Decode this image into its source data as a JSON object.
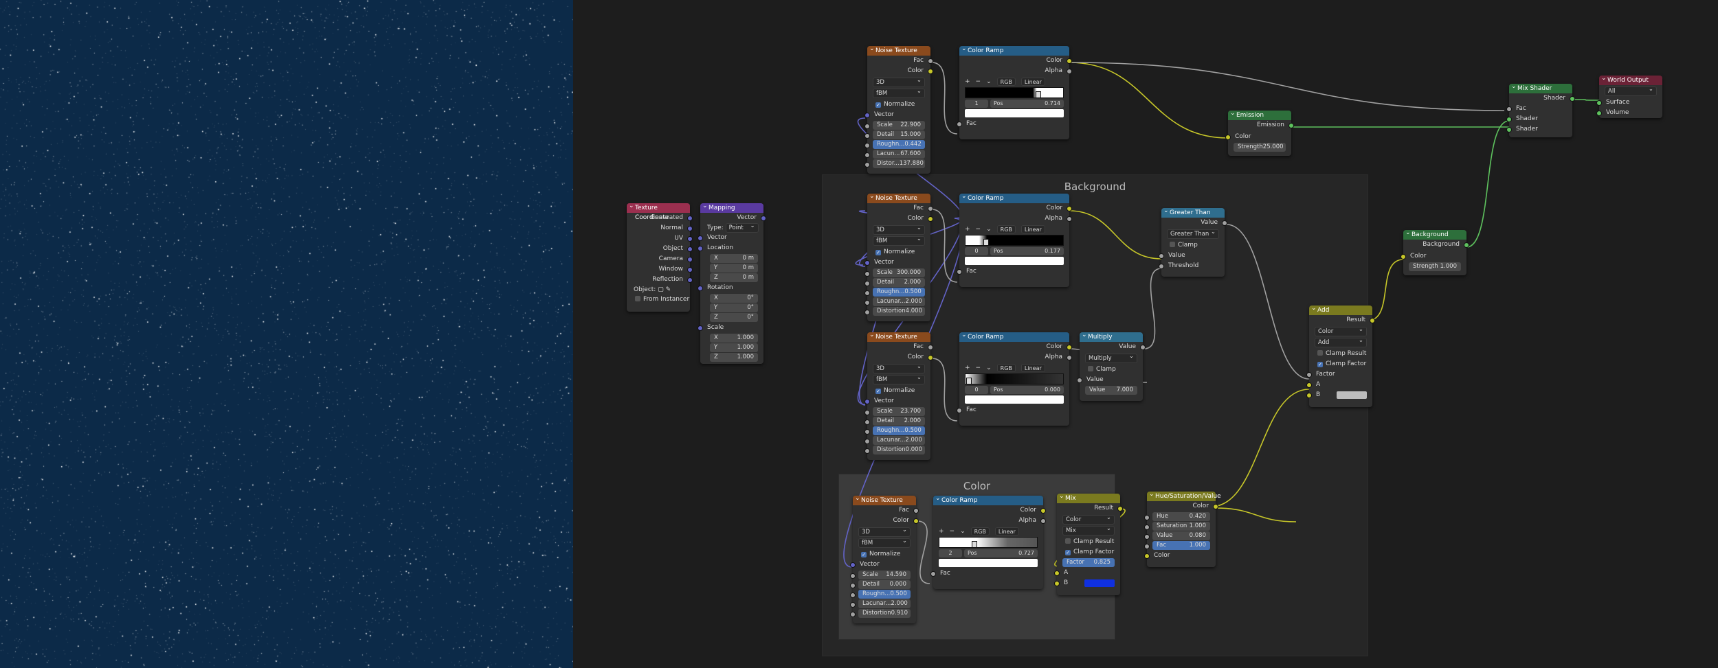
{
  "frames": {
    "background": "Background",
    "color": "Color"
  },
  "labels": {
    "fac": "Fac",
    "color": "Color",
    "alpha": "Alpha",
    "vector": "Vector",
    "normalize": "Normalize",
    "scale": "Scale",
    "detail": "Detail",
    "roughness": "Roughn...",
    "lacunarity": "Lacun...",
    "lacunarity2": "Lacunar...",
    "distortion": "Distor...",
    "distortion_full": "Distortion",
    "rgb": "RGB",
    "linear": "Linear",
    "pos": "Pos",
    "dim3d": "3D",
    "fbm": "fBM",
    "shader": "Shader",
    "surface": "Surface",
    "volume": "Volume",
    "all": "All",
    "emission": "Emission",
    "strength": "Strength",
    "value": "Value",
    "threshold": "Threshold",
    "clamp": "Clamp",
    "result": "Result",
    "factor": "Factor",
    "a": "A",
    "b": "B",
    "clamp_result": "Clamp Result",
    "clamp_factor": "Clamp Factor",
    "background": "Background",
    "multiply": "Multiply",
    "greater_than": "Greater Than",
    "mix": "Mix",
    "add": "Add",
    "type": "Type:",
    "point": "Point",
    "location": "Location",
    "rotation": "Rotation",
    "x": "X",
    "y": "Y",
    "z": "Z",
    "generated": "Generated",
    "normal": "Normal",
    "uv": "UV",
    "object": "Object",
    "camera": "Camera",
    "window": "Window",
    "reflection": "Reflection",
    "object_field": "Object:",
    "from_instancer": "From Instancer",
    "hue": "Hue",
    "saturation": "Saturation",
    "plus": "+",
    "minus": "−"
  },
  "nodes": {
    "tex_coord": {
      "title": "Texture Coordinate"
    },
    "mapping": {
      "title": "Mapping",
      "loc": [
        "0 m",
        "0 m",
        "0 m"
      ],
      "rot": [
        "0°",
        "0°",
        "0°"
      ],
      "scale": [
        "1.000",
        "1.000",
        "1.000"
      ]
    },
    "noise1": {
      "title": "Noise Texture",
      "scale": "22.900",
      "detail": "15.000",
      "rough": "0.442",
      "lacun": "67.600",
      "distort": "137.880"
    },
    "noise2": {
      "title": "Noise Texture",
      "scale": "300.000",
      "detail": "2.000",
      "rough": "0.500",
      "lacun": "2.000",
      "distort": "4.000"
    },
    "noise3": {
      "title": "Noise Texture",
      "scale": "23.700",
      "detail": "2.000",
      "rough": "0.500",
      "lacun": "2.000",
      "distort": "0.000"
    },
    "noise4": {
      "title": "Noise Texture",
      "scale": "14.590",
      "detail": "0.000",
      "rough": "0.500",
      "lacun": "2.000",
      "distort": "0.910"
    },
    "ramp1": {
      "title": "Color Ramp",
      "idx": "1",
      "pos": "0.714"
    },
    "ramp2": {
      "title": "Color Ramp",
      "idx": "0",
      "pos": "0.177"
    },
    "ramp3": {
      "title": "Color Ramp",
      "idx": "0",
      "pos": "0.000"
    },
    "ramp4": {
      "title": "Color Ramp",
      "idx": "2",
      "pos": "0.727"
    },
    "emission": {
      "title": "Emission",
      "strength": "25.000"
    },
    "greater": {
      "title": "Greater Than"
    },
    "multiply": {
      "title": "Multiply",
      "value": "7.000"
    },
    "background": {
      "title": "Background",
      "strength": "1.000"
    },
    "add": {
      "title": "Add"
    },
    "mix": {
      "title": "Mix",
      "factor": "0.825"
    },
    "hsv": {
      "title": "Hue/Saturation/Value",
      "hue": "0.420",
      "saturation": "1.000",
      "value": "0.080",
      "fac": "1.000"
    },
    "mix_shader": {
      "title": "Mix Shader"
    },
    "world_output": {
      "title": "World Output"
    }
  },
  "colors": {
    "viewport_bg": "#0c2a48",
    "mix_b": "#1030e0",
    "add_b": "#bdbdbd",
    "wire_yellow": "#c7c729",
    "wire_gray": "#a1a1a1",
    "wire_purple": "#6363c7",
    "wire_green": "#5ec25e"
  }
}
